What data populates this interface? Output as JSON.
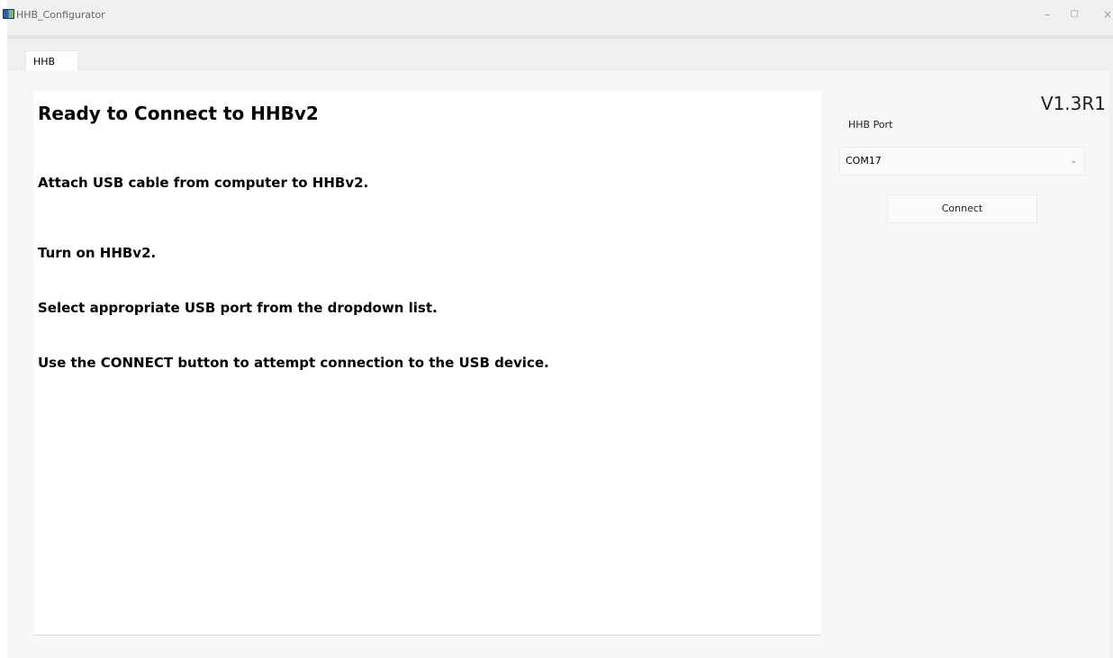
{
  "window": {
    "title": "HHB_Configurator",
    "controls": {
      "minimize": "–",
      "maximize": "▢",
      "close": "×"
    }
  },
  "tabs": [
    {
      "label": "HHB",
      "active": true
    }
  ],
  "panel": {
    "title": "Ready to Connect to HHBv2",
    "instructions": [
      "Attach USB cable from computer to HHBv2.",
      "Turn on HHBv2.",
      "Select appropriate USB port from the dropdown list.",
      "Use the CONNECT button to attempt connection to the USB device."
    ]
  },
  "sidebar": {
    "version": "V1.3R1",
    "port_label": "HHB Port",
    "port_value": "COM17",
    "chevron": "⌄",
    "connect_label": "Connect"
  },
  "icons": {
    "app": "app-icon",
    "dropdown": "chevron-down-icon"
  },
  "colors": {
    "window_bg": "#f0f0f0",
    "panel_bg": "#ffffff",
    "text": "#000000"
  }
}
